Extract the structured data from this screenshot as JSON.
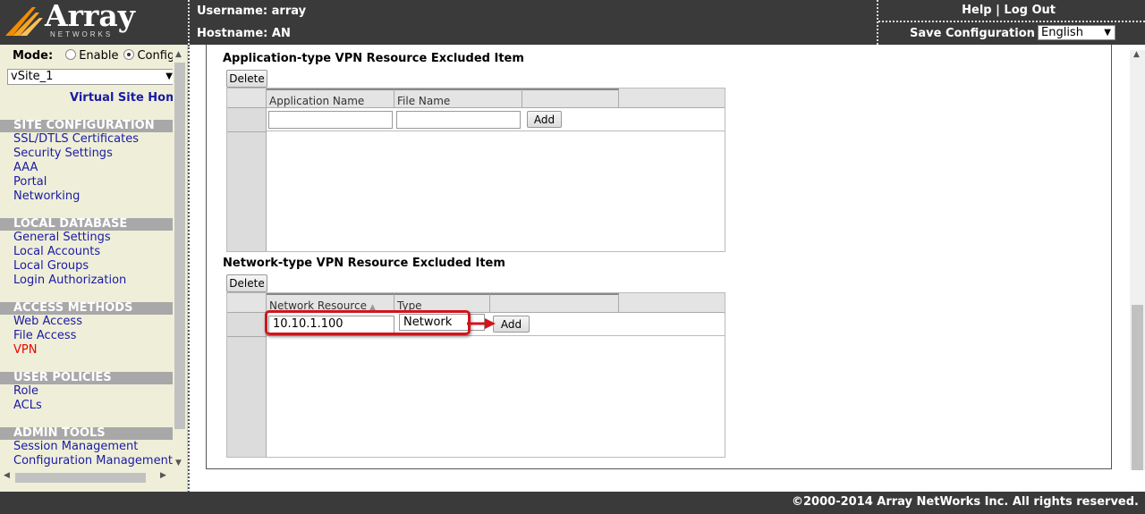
{
  "brand": {
    "word": "Array",
    "sub": "NETWORKS"
  },
  "header": {
    "username": "Username: array",
    "hostname": "Hostname: AN",
    "help": "Help",
    "sep": "|",
    "logout": "Log Out",
    "save_config": "Save Configuration",
    "language": "English"
  },
  "sidebar": {
    "mode_label": "Mode:",
    "mode_enable": "Enable",
    "mode_config": "Config",
    "vsite": "vSite_1",
    "vsite_home": "Virtual Site Home",
    "sections": [
      {
        "title": "SITE CONFIGURATION",
        "items": [
          "SSL/DTLS Certificates",
          "Security Settings",
          "AAA",
          "Portal",
          "Networking"
        ]
      },
      {
        "title": "LOCAL DATABASE",
        "items": [
          "General Settings",
          "Local Accounts",
          "Local Groups",
          "Login Authorization"
        ]
      },
      {
        "title": "ACCESS METHODS",
        "items": [
          "Web Access",
          "File Access",
          "VPN"
        ]
      },
      {
        "title": "USER POLICIES",
        "items": [
          "Role",
          "ACLs"
        ]
      },
      {
        "title": "ADMIN TOOLS",
        "items": [
          "Session Management",
          "Configuration Management"
        ]
      }
    ]
  },
  "app_section": {
    "title": "Application-type VPN Resource Excluded Item",
    "delete": "Delete",
    "col1": "Application Name",
    "col2": "File Name",
    "add": "Add"
  },
  "net_section": {
    "title": "Network-type VPN Resource Excluded Item",
    "delete": "Delete",
    "col1": "Network Resource",
    "col2": "Type",
    "resource_value": "10.10.1.100",
    "type_value": "Network",
    "add": "Add"
  },
  "footer": {
    "copyright": "©2000-2014 Array NetWorks Inc. All rights reserved."
  },
  "colors": {
    "header_bg": "#3a3a3a",
    "sidebar_bg": "#efefd9",
    "link": "#1a1aa6",
    "active_link": "#e00000",
    "callout": "#d0151c"
  }
}
